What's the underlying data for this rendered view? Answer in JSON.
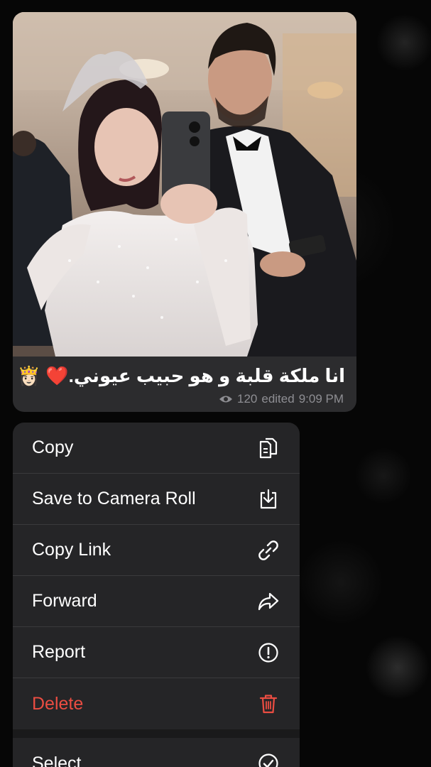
{
  "message": {
    "caption": "انا ملكة قلبة و هو حبيب  عيوني.❤️ 👸🏻",
    "views": "120",
    "edited_label": "edited",
    "time": "9:09 PM"
  },
  "menu": {
    "items": [
      {
        "label": "Copy",
        "icon": "copy-icon"
      },
      {
        "label": "Save to Camera Roll",
        "icon": "save-download-icon"
      },
      {
        "label": "Copy Link",
        "icon": "link-icon"
      },
      {
        "label": "Forward",
        "icon": "forward-arrow-icon"
      },
      {
        "label": "Report",
        "icon": "report-exclamation-icon"
      },
      {
        "label": "Delete",
        "icon": "trash-icon",
        "destructive": true
      },
      {
        "label": "Select",
        "icon": "checkmark-circle-icon"
      }
    ]
  },
  "colors": {
    "bubble": "#2c2c2e",
    "menu": "#252527",
    "destructive": "#eb4d42",
    "meta": "#8e8e93"
  }
}
